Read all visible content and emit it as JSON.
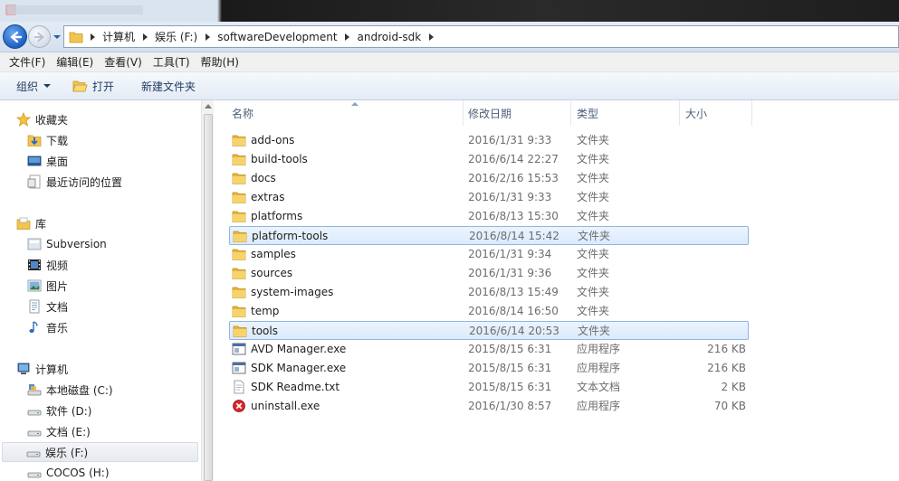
{
  "titlebar": {
    "title": ""
  },
  "address": {
    "crumbs": [
      "计算机",
      "娱乐 (F:)",
      "softwareDevelopment",
      "android-sdk"
    ]
  },
  "menu": [
    "文件(F)",
    "编辑(E)",
    "查看(V)",
    "工具(T)",
    "帮助(H)"
  ],
  "toolbar": {
    "organize": "组织",
    "open": "打开",
    "new_folder": "新建文件夹"
  },
  "sidebar": {
    "favorites": {
      "label": "收藏夹",
      "items": [
        "下载",
        "桌面",
        "最近访问的位置"
      ]
    },
    "libraries": {
      "label": "库",
      "items": [
        "Subversion",
        "视频",
        "图片",
        "文档",
        "音乐"
      ]
    },
    "computer": {
      "label": "计算机",
      "items": [
        "本地磁盘 (C:)",
        "软件 (D:)",
        "文档 (E:)",
        "娱乐 (F:)",
        "COCOS (H:)"
      ],
      "selected": "娱乐 (F:)"
    }
  },
  "columns": {
    "name": "名称",
    "date": "修改日期",
    "type": "类型",
    "size": "大小"
  },
  "files": [
    {
      "name": "add-ons",
      "date": "2016/1/31 9:33",
      "type": "文件夹",
      "size": "",
      "icon": "folder-icon",
      "selected": false
    },
    {
      "name": "build-tools",
      "date": "2016/6/14 22:27",
      "type": "文件夹",
      "size": "",
      "icon": "folder-icon",
      "selected": false
    },
    {
      "name": "docs",
      "date": "2016/2/16 15:53",
      "type": "文件夹",
      "size": "",
      "icon": "folder-icon",
      "selected": false
    },
    {
      "name": "extras",
      "date": "2016/1/31 9:33",
      "type": "文件夹",
      "size": "",
      "icon": "folder-icon",
      "selected": false
    },
    {
      "name": "platforms",
      "date": "2016/8/13 15:30",
      "type": "文件夹",
      "size": "",
      "icon": "folder-icon",
      "selected": false
    },
    {
      "name": "platform-tools",
      "date": "2016/8/14 15:42",
      "type": "文件夹",
      "size": "",
      "icon": "folder-icon",
      "selected": true
    },
    {
      "name": "samples",
      "date": "2016/1/31 9:34",
      "type": "文件夹",
      "size": "",
      "icon": "folder-icon",
      "selected": false
    },
    {
      "name": "sources",
      "date": "2016/1/31 9:36",
      "type": "文件夹",
      "size": "",
      "icon": "folder-icon",
      "selected": false
    },
    {
      "name": "system-images",
      "date": "2016/8/13 15:49",
      "type": "文件夹",
      "size": "",
      "icon": "folder-icon",
      "selected": false
    },
    {
      "name": "temp",
      "date": "2016/8/14 16:50",
      "type": "文件夹",
      "size": "",
      "icon": "folder-icon",
      "selected": false
    },
    {
      "name": "tools",
      "date": "2016/6/14 20:53",
      "type": "文件夹",
      "size": "",
      "icon": "folder-icon",
      "selected": true
    },
    {
      "name": "AVD Manager.exe",
      "date": "2015/8/15 6:31",
      "type": "应用程序",
      "size": "216 KB",
      "icon": "exe-icon",
      "selected": false
    },
    {
      "name": "SDK Manager.exe",
      "date": "2015/8/15 6:31",
      "type": "应用程序",
      "size": "216 KB",
      "icon": "exe-icon",
      "selected": false
    },
    {
      "name": "SDK Readme.txt",
      "date": "2015/8/15 6:31",
      "type": "文本文档",
      "size": "2 KB",
      "icon": "text-file-icon",
      "selected": false
    },
    {
      "name": "uninstall.exe",
      "date": "2016/1/30 8:57",
      "type": "应用程序",
      "size": "70 KB",
      "icon": "uninstall-icon",
      "selected": false
    }
  ],
  "colors": {
    "selection_border": "#8fb6e2",
    "selection_fill": "#dbeafc",
    "folder": "#f3c44f"
  }
}
